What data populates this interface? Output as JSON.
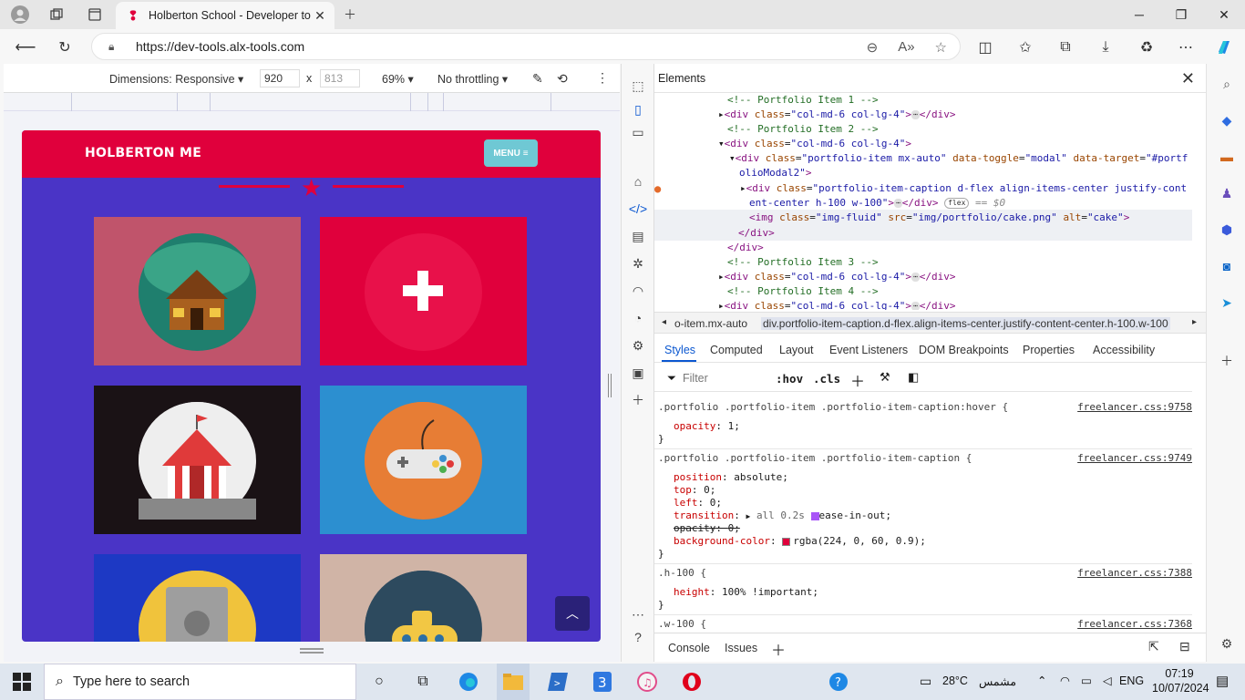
{
  "browser": {
    "tab_title": "Holberton School - Developer to",
    "url": "https://dev-tools.alx-tools.com"
  },
  "device_toolbar": {
    "dimensions_label": "Dimensions: Responsive",
    "width": "920",
    "separator": "x",
    "height_placeholder": "813",
    "zoom": "69%",
    "throttling": "No throttling"
  },
  "site": {
    "brand": "HOLBERTON ME",
    "menu_label": "MENU",
    "colors": {
      "nav": "#e0003c",
      "body": "#4a34c6",
      "accent": "#6fc8d4"
    }
  },
  "devtools": {
    "panel_title": "Elements",
    "dom_lines": {
      "c1": "<!-- Portfolio Item 1 -->",
      "c2": "<!-- Portfolio Item 2 -->",
      "c3": "<!-- Portfolio Item 3 -->",
      "c4": "<!-- Portfolio Item 4 -->",
      "div_col": "div",
      "class_attr": "class",
      "col_val": "\"col-md-6 col-lg-4\"",
      "item_val": "\"portfolio-item mx-auto\"",
      "toggle_attr": "data-toggle",
      "toggle_val": "\"modal\"",
      "target_attr": "data-target",
      "target_val": "\"#portf",
      "target_val2": "olioModal2\"",
      "caption_val": "\"portfolio-item-caption d-flex align-items-center justify-cont",
      "caption_val2": "ent-center h-100 w-100\"",
      "flex_badge": "flex",
      "eq_dollar": "== $0",
      "img_src_attr": "src",
      "img_src_val": "\"img/portfolio/cake.png\"",
      "img_alt_attr": "alt",
      "img_alt_val": "\"cake\"",
      "img_class_val": "\"img-fluid\""
    },
    "breadcrumb": {
      "left": "o-item.mx-auto",
      "right": "div.portfolio-item-caption.d-flex.align-items-center.justify-content-center.h-100.w-100"
    },
    "tabs": [
      "Styles",
      "Computed",
      "Layout",
      "Event Listeners",
      "DOM Breakpoints",
      "Properties",
      "Accessibility"
    ],
    "filter_placeholder": "Filter",
    "hov": ":hov",
    "cls": ".cls",
    "rules": {
      "r1_selector": ".portfolio .portfolio-item .portfolio-item-caption:hover {",
      "r1_source": "freelancer.css:9758",
      "r1_p1": "opacity",
      "r1_v1": "1;",
      "r2_selector": ".portfolio .portfolio-item .portfolio-item-caption {",
      "r2_source": "freelancer.css:9749",
      "r2_p1": "position",
      "r2_v1": "absolute;",
      "r2_p2": "top",
      "r2_v2": "0;",
      "r2_p3": "left",
      "r2_v3": "0;",
      "r2_p4": "transition",
      "r2_v4a": "all 0.2s",
      "r2_v4b": "ease-in-out;",
      "r2_p5": "opacity",
      "r2_v5": "0;",
      "r2_p6": "background-color",
      "r2_v6": "rgba(224, 0, 60, 0.9);",
      "r3_selector": ".h-100 {",
      "r3_source": "freelancer.css:7388",
      "r3_p1": "height",
      "r3_v1": "100% !important;",
      "r4_selector": ".w-100 {",
      "r4_source": "freelancer.css:7368",
      "close_brace": "}"
    },
    "drawer_tabs": [
      "Console",
      "Issues"
    ]
  },
  "taskbar": {
    "search_placeholder": "Type here to search",
    "temperature": "28°C",
    "weather": "مشمس",
    "language": "ENG",
    "time": "07:19",
    "date": "10/07/2024"
  }
}
